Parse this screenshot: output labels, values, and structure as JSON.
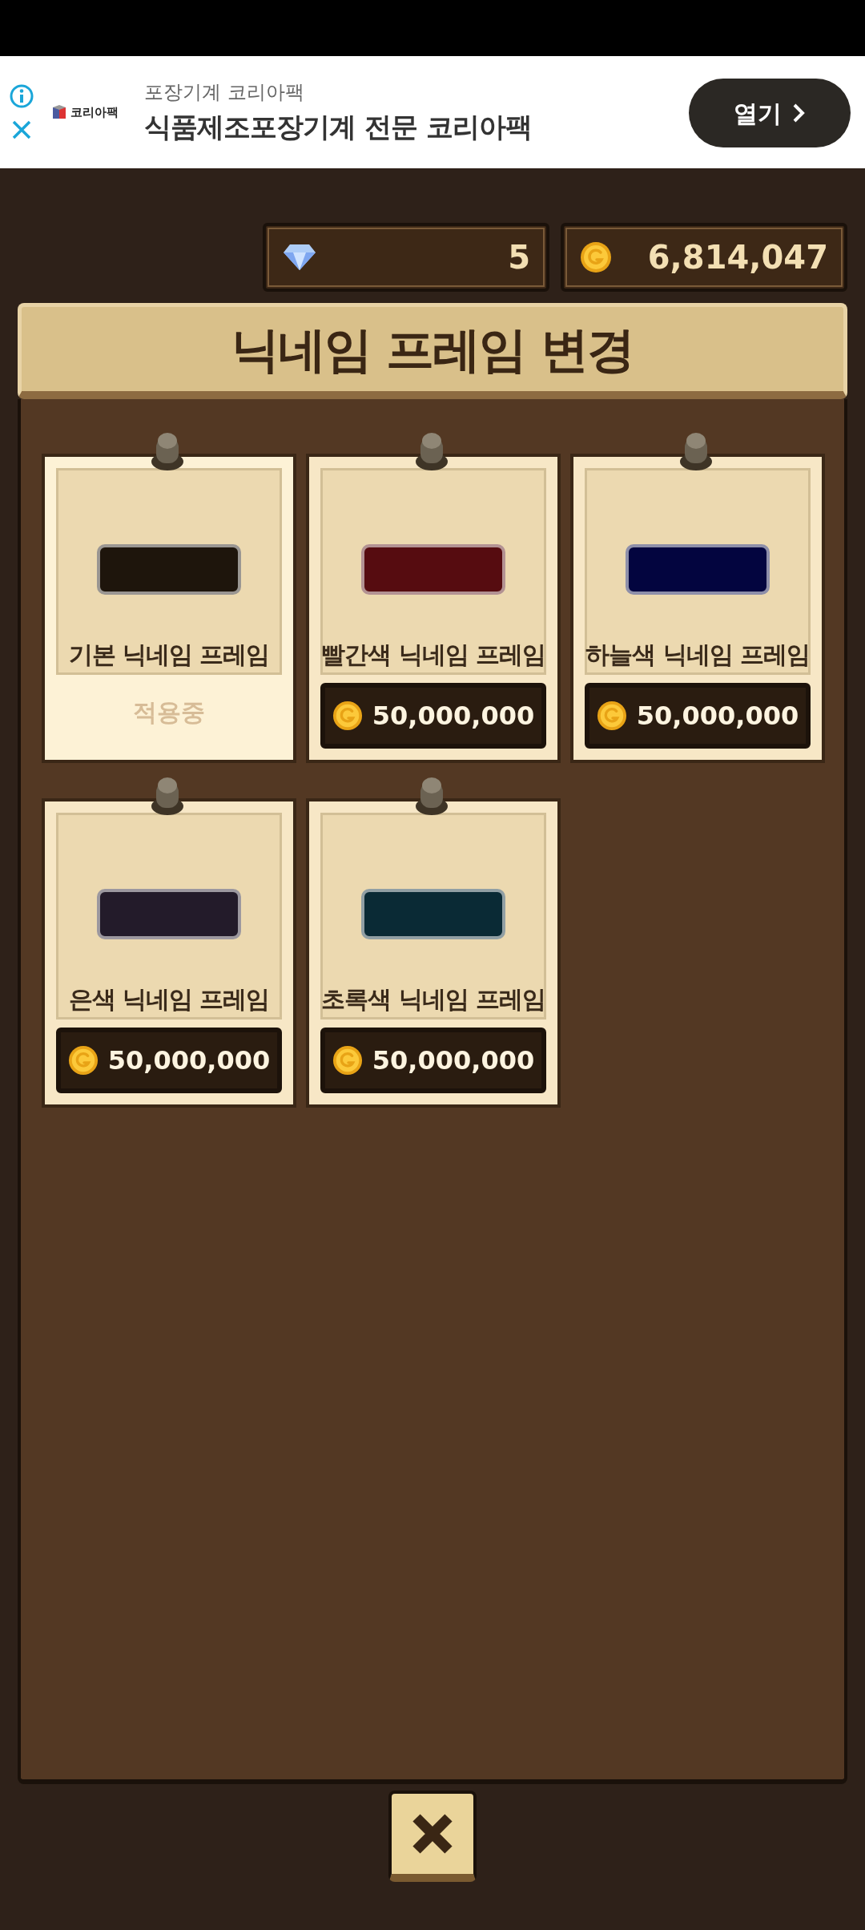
{
  "ad": {
    "brand": "코리아팩",
    "subtitle": "포장기계 코리아팩",
    "headline": "식품제조포장기계 전문 코리아팩",
    "open_button": "열기"
  },
  "currency": {
    "gems": "5",
    "gold": "6,814,047"
  },
  "title": "닉네임 프레임 변경",
  "cards": [
    {
      "name": "기본 닉네임 프레임",
      "applied": true,
      "status": "적용중",
      "color": "#1e150c"
    },
    {
      "name": "빨간색 닉네임 프레임",
      "applied": false,
      "price": "50,000,000",
      "color": "#560c10"
    },
    {
      "name": "하늘색 닉네임 프레임",
      "applied": false,
      "price": "50,000,000",
      "color": "#03053f"
    },
    {
      "name": "은색 닉네임 프레임",
      "applied": false,
      "price": "50,000,000",
      "color": "#231b2a"
    },
    {
      "name": "초록색 닉네임 프레임",
      "applied": false,
      "price": "50,000,000",
      "color": "#0a2a35"
    }
  ]
}
